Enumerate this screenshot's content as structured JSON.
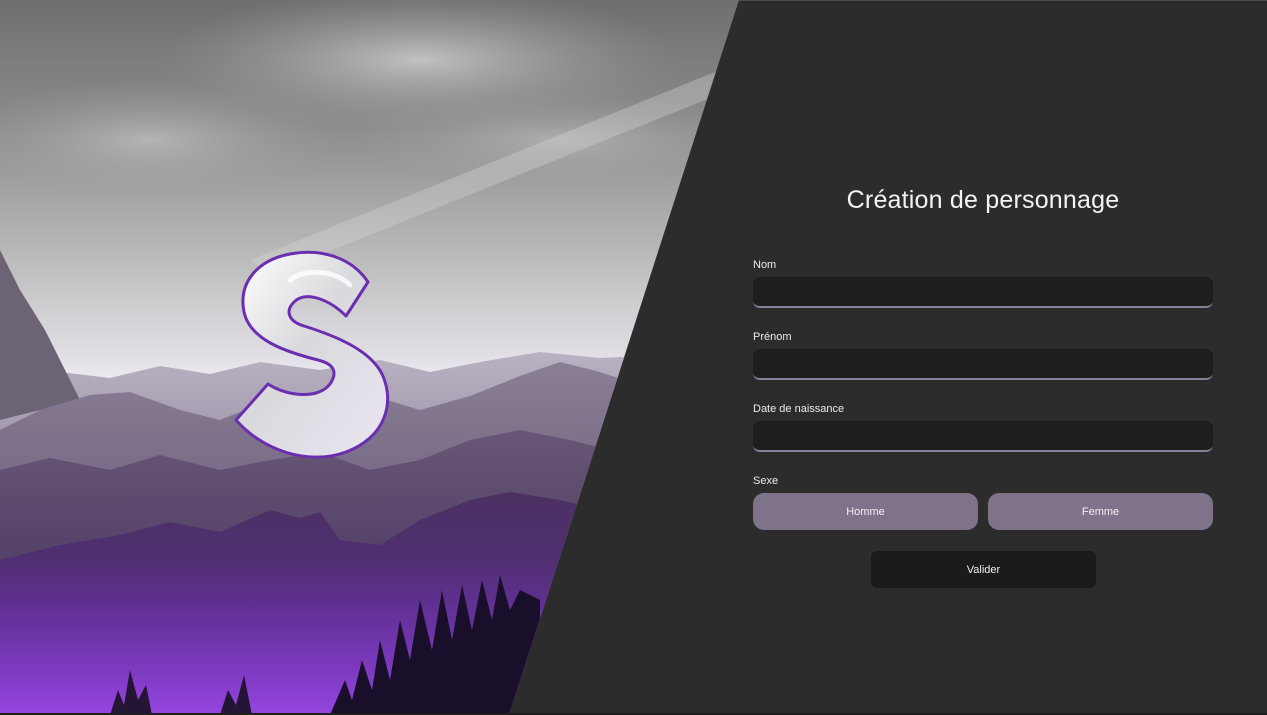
{
  "logo": {
    "letter": "S"
  },
  "form": {
    "title": "Création de personnage",
    "fields": [
      {
        "label": "Nom",
        "value": "",
        "placeholder": ""
      },
      {
        "label": "Prénom",
        "value": "",
        "placeholder": ""
      },
      {
        "label": "Date de naissance",
        "value": "",
        "placeholder": ""
      }
    ],
    "sex": {
      "label": "Sexe",
      "options": [
        "Homme",
        "Femme"
      ]
    },
    "submit_label": "Valider"
  },
  "colors": {
    "background": "#2c2c2c",
    "input_background": "#1e1e1e",
    "input_underline": "#8a7f99",
    "sex_button": "#7e7389",
    "submit_button": "#1b1b1b",
    "accent_purple": "#6a2fb0"
  },
  "icons": {
    "logo": "letter-s-logo",
    "hero": "mountain-landscape-image"
  }
}
